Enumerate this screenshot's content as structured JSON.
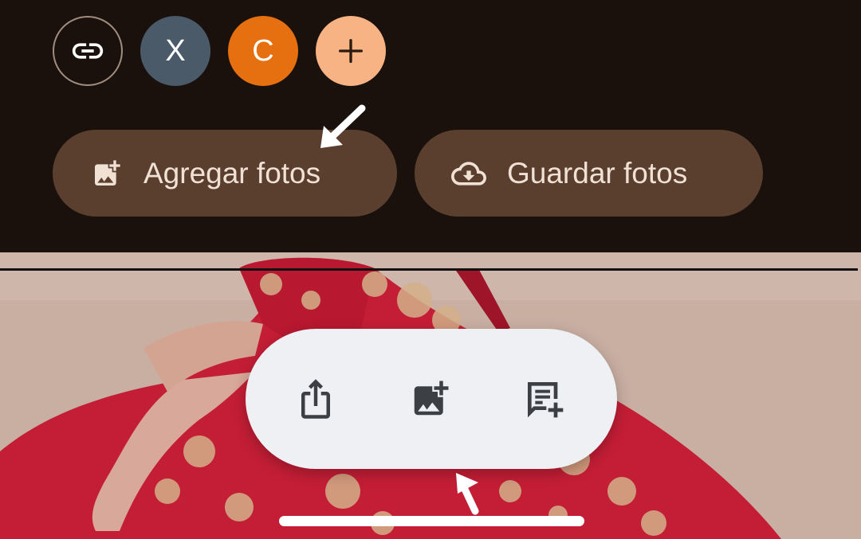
{
  "header": {
    "share_link_icon": "link-icon",
    "participants": [
      {
        "initial": "X",
        "color": "#4a5a68"
      },
      {
        "initial": "C",
        "color": "#e6700f"
      }
    ],
    "add_participant_icon": "plus-icon"
  },
  "actions": {
    "add_photos_label": "Agregar fotos",
    "save_photos_label": "Guardar fotos"
  },
  "photo_toolbar": {
    "icons": [
      "share-icon",
      "add-photo-icon",
      "add-comment-icon"
    ]
  },
  "colors": {
    "background": "#1a110c",
    "button": "#5a3f2e",
    "button_text": "#f1e1d4",
    "toolbar": "#eef0f3"
  }
}
